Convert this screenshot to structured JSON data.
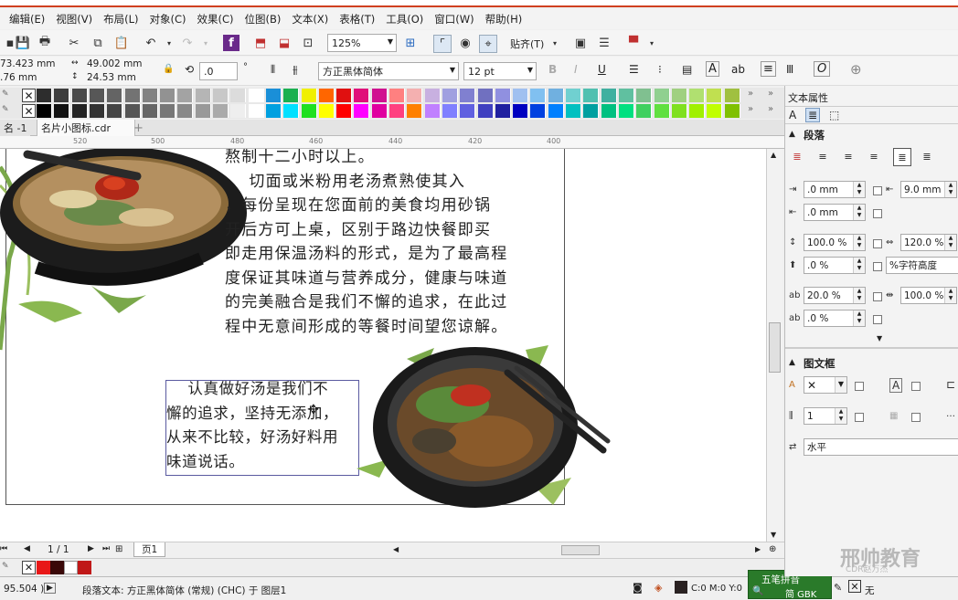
{
  "menu": [
    "编辑(E)",
    "视图(V)",
    "布局(L)",
    "对象(C)",
    "效果(C)",
    "位图(B)",
    "文本(X)",
    "表格(T)",
    "工具(O)",
    "窗口(W)",
    "帮助(H)"
  ],
  "toolbar": {
    "zoom_value": "125%",
    "snap_label": "贴齐(T)"
  },
  "propbar": {
    "x_pos": "73.423 mm",
    "y_pos": ".76 mm",
    "width": "49.002 mm",
    "height": "24.53 mm",
    "rotation": ".0",
    "rotation_unit": "°",
    "font_name": "方正黑体简体",
    "font_size": "12 pt"
  },
  "palette_row1": [
    "#2d2d2d",
    "#3d3d3d",
    "#4a4a4a",
    "#575757",
    "#646464",
    "#737373",
    "#828282",
    "#929292",
    "#a3a3a3",
    "#b5b5b5",
    "#c8c8c8",
    "#dcdcdc",
    "#ffffff",
    "#1a8fd8",
    "#1ab050",
    "#f0f000",
    "#ff6600",
    "#e01010",
    "#e0107a",
    "#d01090",
    "#ff8080",
    "#f4b0b0",
    "#c8b0e0",
    "#a0a0e0",
    "#8080d0",
    "#7070c0",
    "#9090e0",
    "#a0c0f0",
    "#80c0f0",
    "#70b0e0",
    "#70d0d0",
    "#50c0b0",
    "#40b0a0",
    "#60c0a0",
    "#80c090",
    "#90d090",
    "#a0d080",
    "#b0e070",
    "#c0e050",
    "#a0c040"
  ],
  "palette_row2": [
    "#000000",
    "#111111",
    "#222222",
    "#333333",
    "#444444",
    "#555555",
    "#666666",
    "#777777",
    "#888888",
    "#999999",
    "#aaaaaa",
    "#eeeeee",
    "#ffffff",
    "#00a0e0",
    "#00e0ff",
    "#20e020",
    "#ffff00",
    "#ff0000",
    "#ff00ff",
    "#e000a0",
    "#ff4080",
    "#ff8000",
    "#c080ff",
    "#8080ff",
    "#6060e0",
    "#4040c0",
    "#2020a0",
    "#0000c0",
    "#0040e0",
    "#0080ff",
    "#00c0c0",
    "#00a0a0",
    "#00c080",
    "#00e080",
    "#40d060",
    "#60e040",
    "#80e020",
    "#a0f000",
    "#c0ff00",
    "#80c000"
  ],
  "tabs": {
    "tab1": "名 -1",
    "tab2": "名片小图标.cdr"
  },
  "ruler": [
    "520",
    "500",
    "480",
    "460",
    "440",
    "420",
    "400"
  ],
  "doc": {
    "para1": "熬制十二小时以上。\n    切面或米粉用老汤煮熟使其入\n，每份呈现在您面前的美食均用砂锅\n开后方可上桌，区别于路边快餐即买\n即走用保温汤料的形式，是为了最高程\n度保证其味道与营养成分，健康与味道\n的完美融合是我们不懈的追求，在此过\n程中无意间形成的等餐时间望您谅解。",
    "para2": "    认真做好汤是我们不\n懈的追求，坚持无添加，\n从来不比较，好汤好料用\n味道说话。"
  },
  "nav": {
    "page_counter": "1 / 1",
    "page_tab": "页1"
  },
  "status": {
    "coord": "95.504 )",
    "text_info": "段落文本: 方正黑体简体 (常规) (CHC) 于 图层1",
    "fill_info": "C:0 M:0 Y:0",
    "outline_info": "无",
    "ime_label": "五笔拼音",
    "ime_sub": "简 GBK"
  },
  "panel": {
    "title": "文本属性",
    "section_para": "段落",
    "left_indent": ".0 mm",
    "first_indent": "9.0 mm",
    "right_indent": ".0 mm",
    "line_spacing_pct": "100.0 %",
    "char_spacing_pct": "120.0 %",
    "para_before": ".0 %",
    "spacing_unit": "%字符高度",
    "lang_spacing": "20.0 %",
    "word_spacing": "100.0 %",
    "para_after": ".0 %",
    "section_frame": "图文框",
    "columns": "1",
    "direction": "水平"
  },
  "watermark": {
    "text": "邢帅教育",
    "sub": "CDR赵万杰"
  }
}
